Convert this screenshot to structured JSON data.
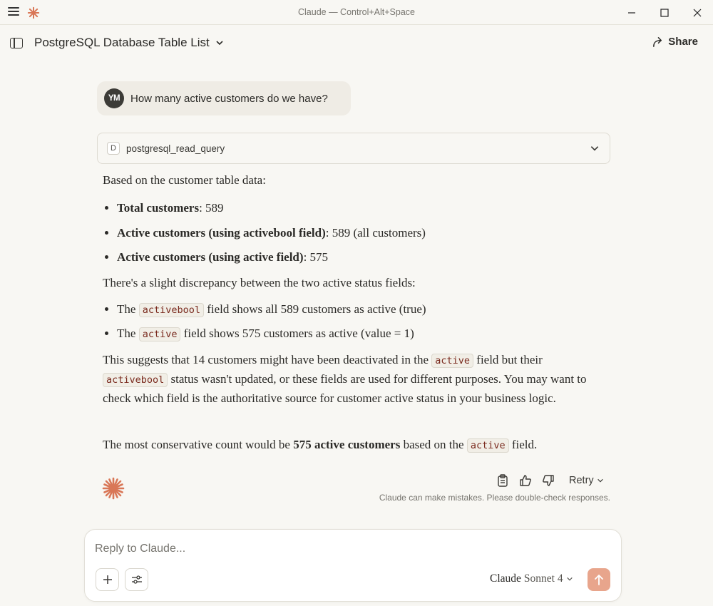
{
  "window": {
    "title": "Claude — Control+Alt+Space"
  },
  "header": {
    "conversation_title": "PostgreSQL Database Table List",
    "share_label": "Share"
  },
  "user_message": {
    "avatar_initials": "YM",
    "text": "How many active customers do we have?"
  },
  "tool_call": {
    "badge": "D",
    "name": "postgresql_read_query"
  },
  "response": {
    "intro": "Based on the customer table data:",
    "stats": [
      {
        "label": "Total customers",
        "value": ": 589"
      },
      {
        "label": "Active customers (using activebool field)",
        "value": ": 589 (all customers)"
      },
      {
        "label": "Active customers (using active field)",
        "value": ": 575"
      }
    ],
    "discrepancy_intro": "There's a slight discrepancy between the two active status fields:",
    "field_notes": [
      {
        "prefix": "The ",
        "code": "activebool",
        "suffix": " field shows all 589 customers as active (true)"
      },
      {
        "prefix": "The ",
        "code": "active",
        "suffix": " field shows 575 customers as active (value = 1)"
      }
    ],
    "suggestion": {
      "part1": "This suggests that 14 customers might have been deactivated in the ",
      "code1": "active",
      "part2": " field but their ",
      "code2": "activebool",
      "part3": " status wasn't updated, or these fields are used for different purposes. You may want to check which field is the authoritative source for customer active status in your business logic."
    },
    "conclusion": {
      "part1": "The most conservative count would be ",
      "bold": "575 active customers",
      "part2": " based on the ",
      "code": "active",
      "part3": " field."
    }
  },
  "actions": {
    "retry_label": "Retry",
    "disclaimer": "Claude can make mistakes. Please double-check responses."
  },
  "composer": {
    "placeholder": "Reply to Claude...",
    "model_name": "Claude",
    "model_version": "Sonnet 4"
  },
  "colors": {
    "accent": "#d97757",
    "send_button": "#e8a58c",
    "background": "#f8f7f3",
    "code_text": "#7a2a1e"
  },
  "icons": [
    "menu-icon",
    "claude-logo-icon",
    "minimize-icon",
    "maximize-icon",
    "close-icon",
    "sidebar-toggle-icon",
    "chevron-down-icon",
    "share-icon",
    "copy-icon",
    "thumbs-up-icon",
    "thumbs-down-icon",
    "plus-icon",
    "sliders-icon",
    "arrow-up-icon"
  ]
}
